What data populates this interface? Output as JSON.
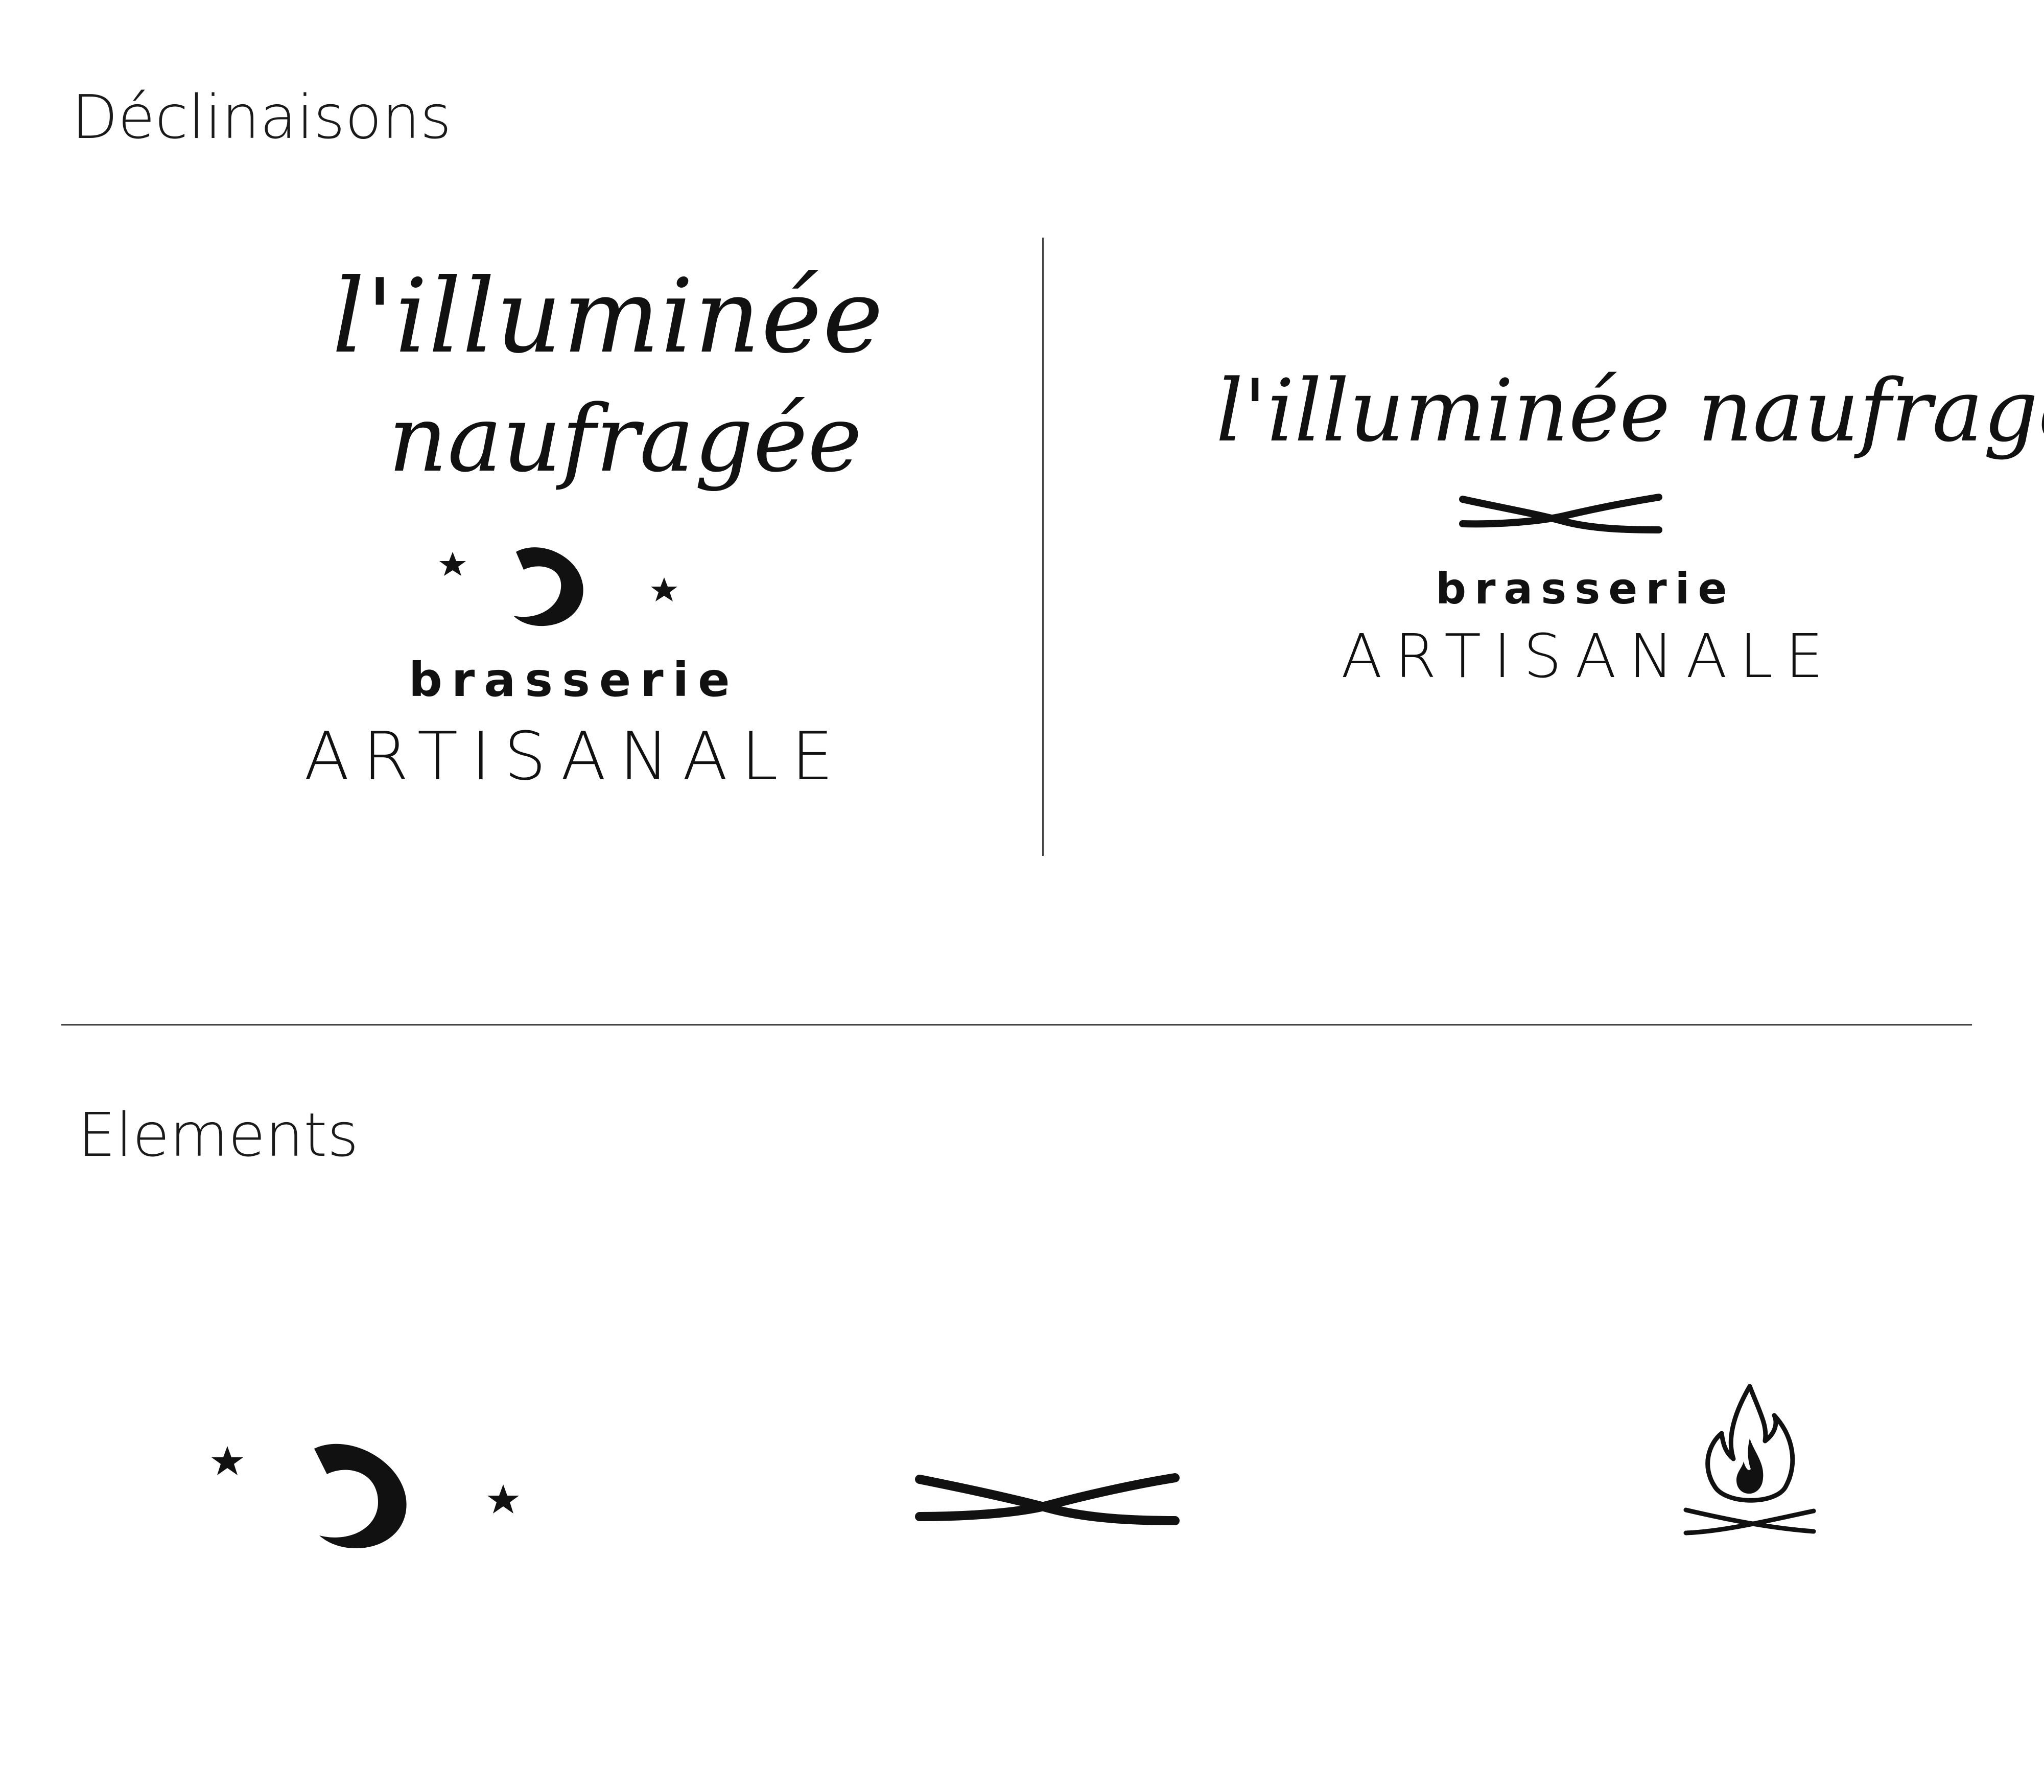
{
  "sections": {
    "declinaisons_title": "Déclinaisons",
    "elements_title": "Elements"
  },
  "logo_stacked": {
    "script_line1": "l'illuminée",
    "script_line2": "naufragée",
    "brasserie": "brasserie",
    "artisanale": "ARTISANALE"
  },
  "logo_horizontal": {
    "script": "l'illuminée naufragée",
    "brasserie": "brasserie",
    "artisanale": "ARTISANALE"
  },
  "elements": [
    {
      "icon": "moon-stars-icon"
    },
    {
      "icon": "crossed-logs-icon"
    },
    {
      "icon": "campfire-icon"
    }
  ],
  "colors": {
    "ink": "#111111",
    "rule": "#444444",
    "background": "#ffffff"
  }
}
